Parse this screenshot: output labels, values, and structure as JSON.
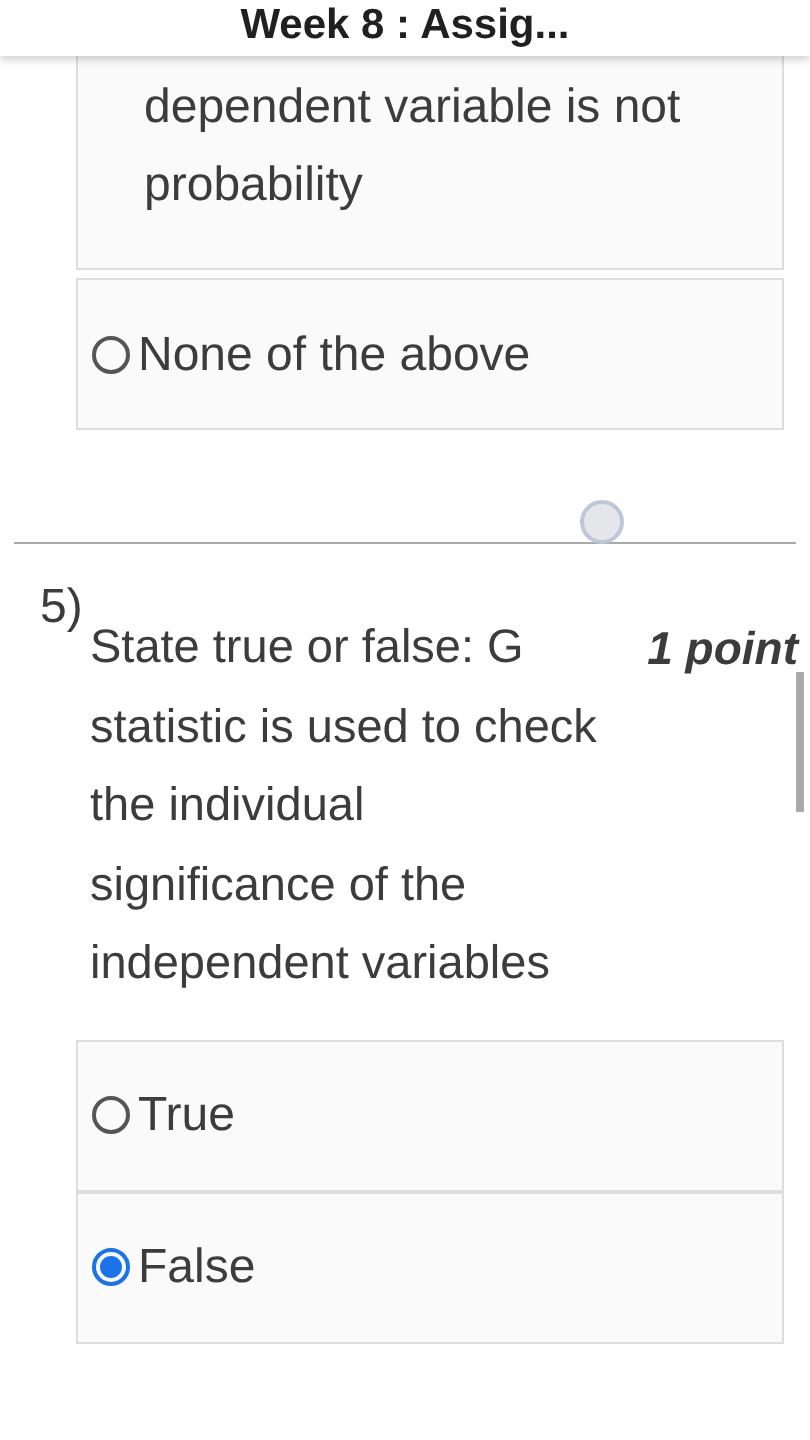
{
  "header": {
    "title": "Week 8 : Assig..."
  },
  "previous_question": {
    "options": [
      {
        "label": "dependent variable is not probability",
        "kind": "continued",
        "selected": false
      },
      {
        "label": "None of the above",
        "kind": "radio",
        "selected": false
      }
    ]
  },
  "question": {
    "number": "5)",
    "text": "State true or false: G statistic is used to check the individual significance of the independent variables",
    "points": "1 point",
    "options": [
      {
        "label": "True",
        "kind": "radio",
        "selected": false
      },
      {
        "label": "False",
        "kind": "radio",
        "selected": true
      }
    ]
  }
}
